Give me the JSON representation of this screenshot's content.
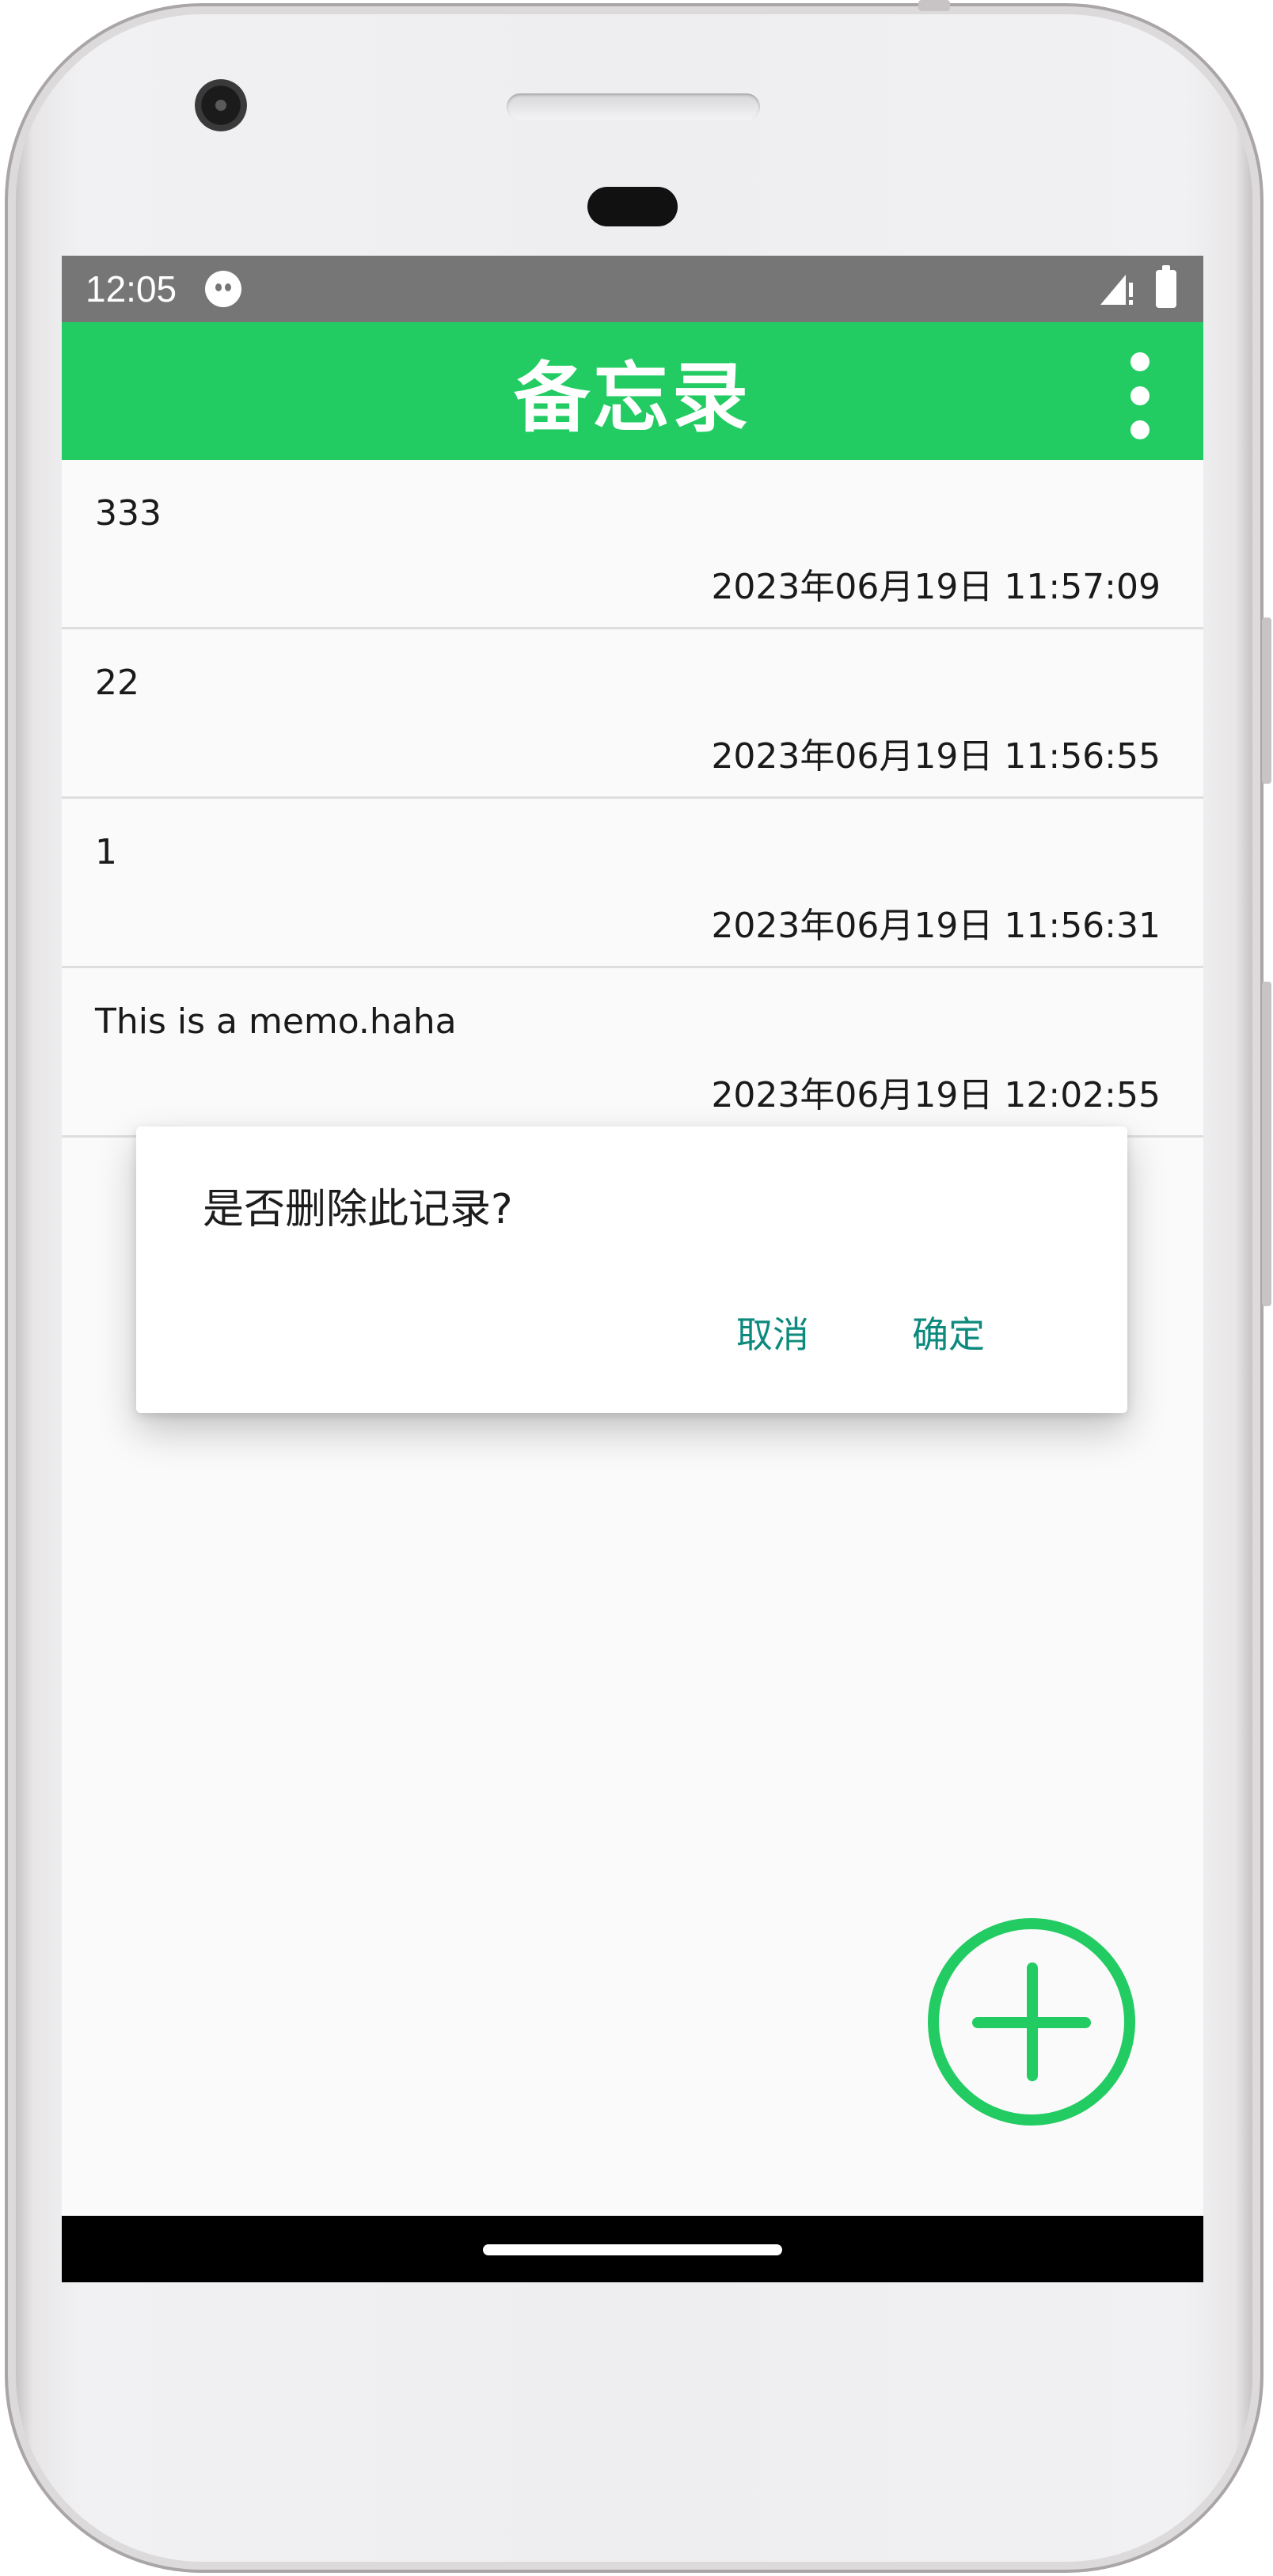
{
  "status_bar": {
    "time": "12:05",
    "app_icon": "android-debug-icon",
    "signal_icon": "signal-no-data-icon",
    "battery_icon": "battery-full-icon"
  },
  "app_bar": {
    "title": "备忘录",
    "menu_icon": "more-vert-icon"
  },
  "memos": [
    {
      "content": "333",
      "time": "2023年06月19日 11:57:09"
    },
    {
      "content": "22",
      "time": "2023年06月19日 11:56:55"
    },
    {
      "content": "1",
      "time": "2023年06月19日 11:56:31"
    },
    {
      "content": "This is a memo.haha",
      "time": "2023年06月19日 12:02:55"
    }
  ],
  "dialog": {
    "message": "是否删除此记录?",
    "cancel_label": "取消",
    "ok_label": "确定"
  },
  "fab": {
    "icon": "add-circle-icon"
  },
  "colors": {
    "accent": "#22cc62",
    "status_bar": "#767676",
    "dialog_button": "#0d8a7e",
    "background": "#fafafa"
  }
}
